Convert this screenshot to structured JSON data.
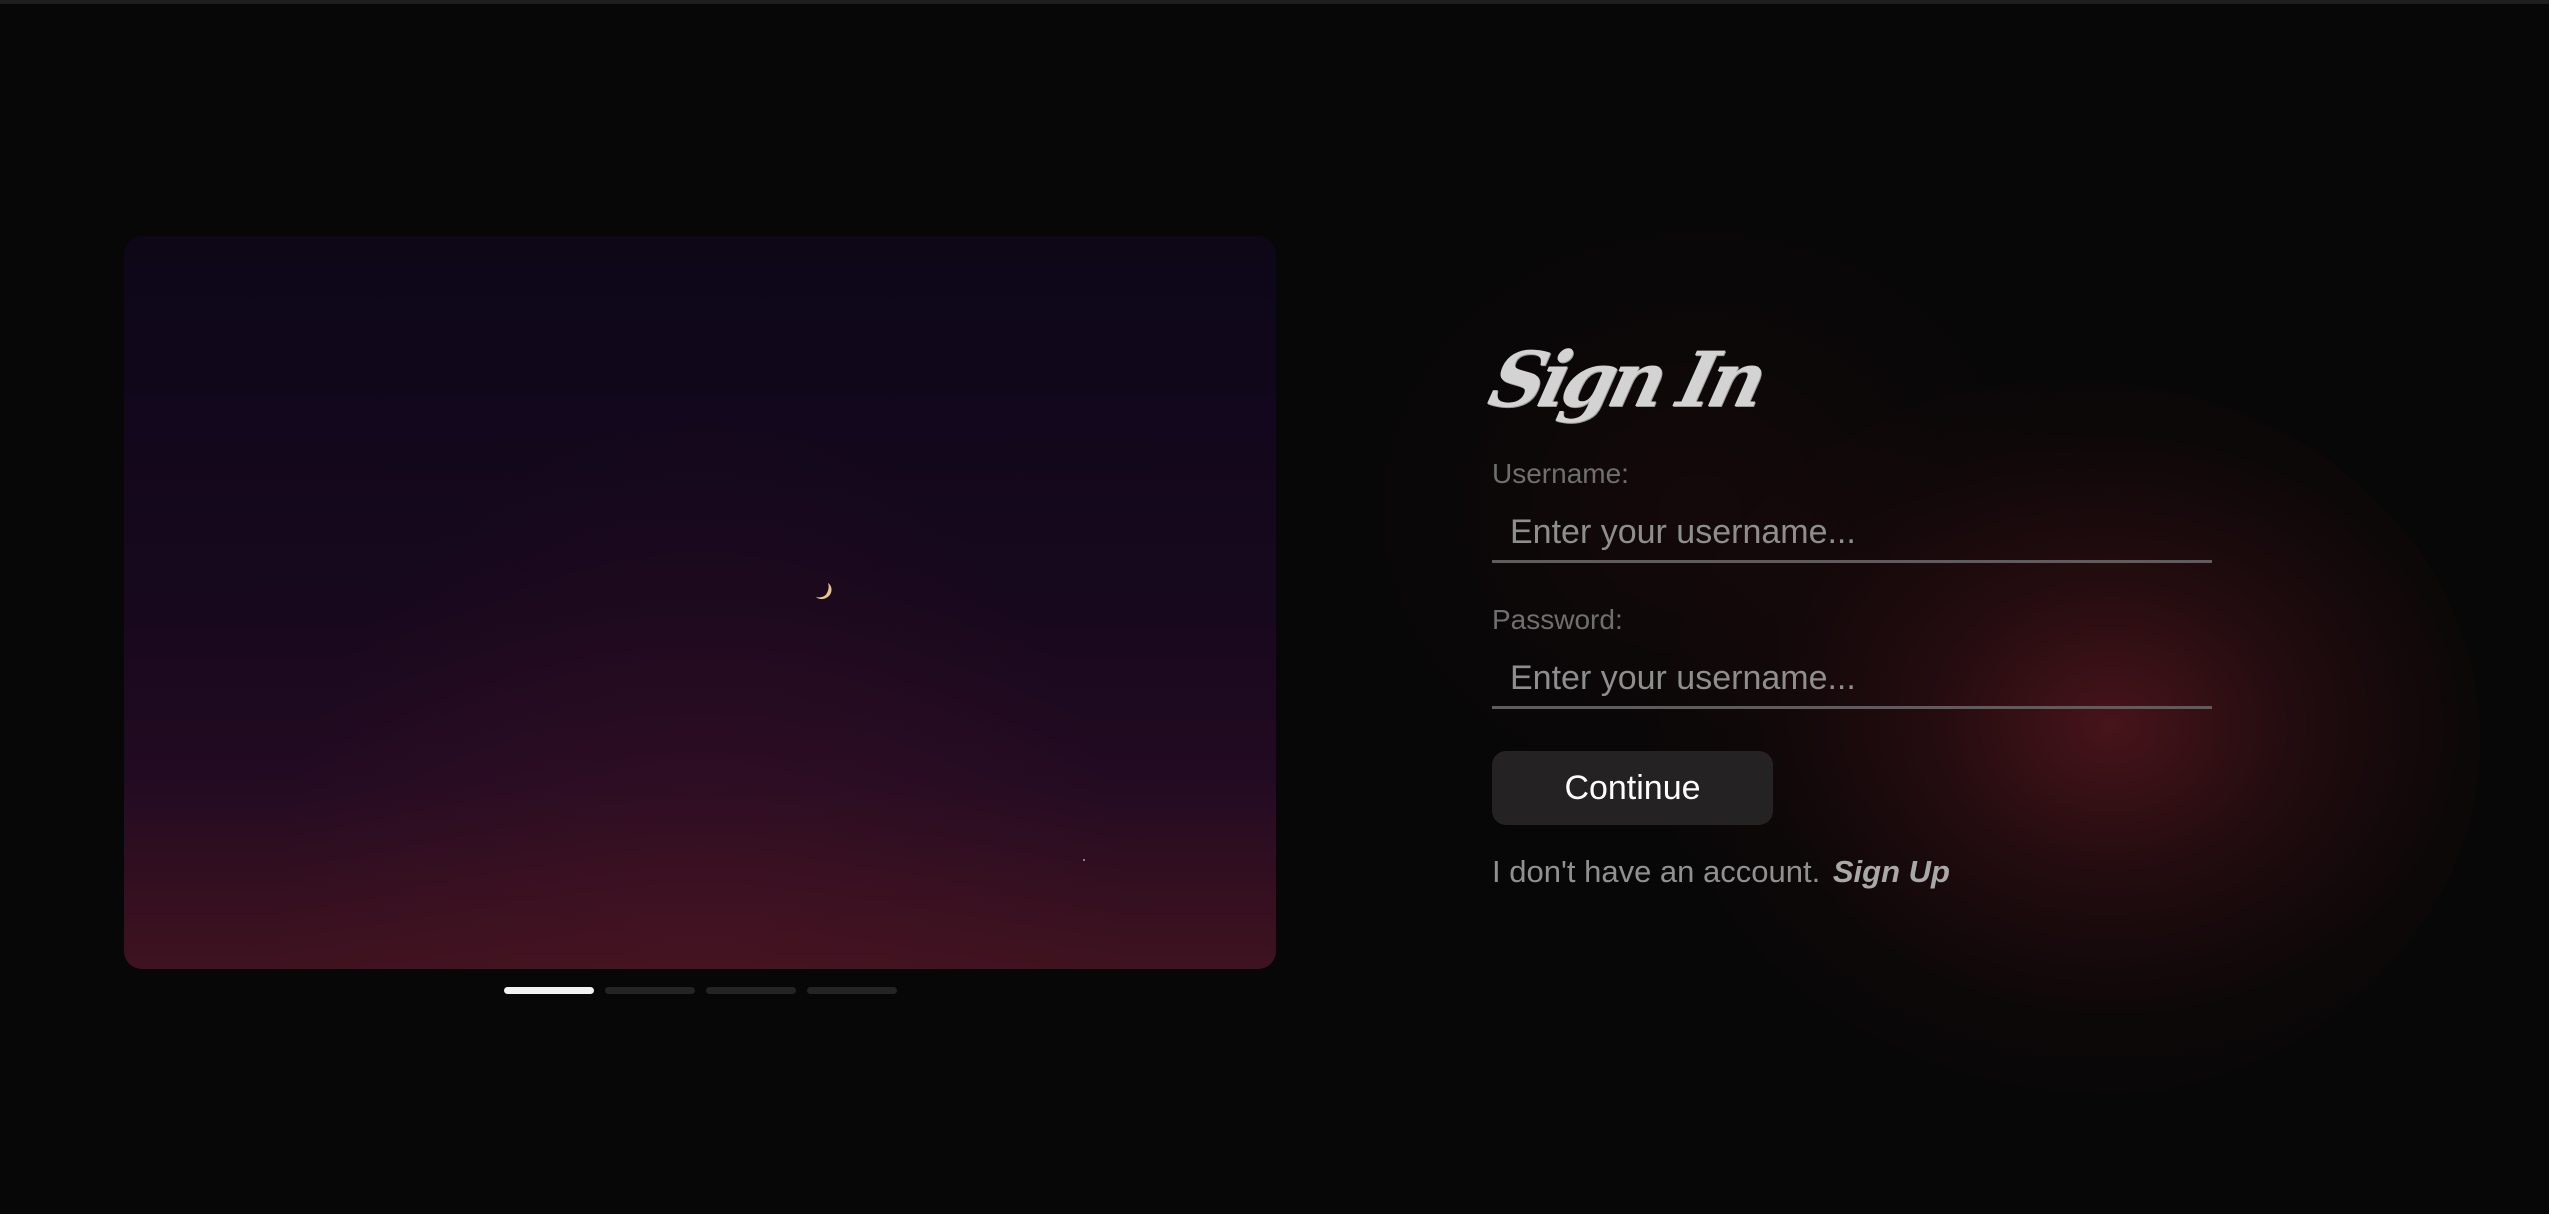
{
  "login": {
    "title": "Sign In",
    "username": {
      "label": "Username:",
      "placeholder": "Enter your username..."
    },
    "password": {
      "label": "Password:",
      "placeholder": "Enter your username..."
    },
    "continue_label": "Continue",
    "no_account_text": "I don't have an account.",
    "signup_label": "Sign Up"
  },
  "carousel": {
    "image": "night-sky-crescent-moon",
    "slide_count": 4,
    "active_slide": 1
  },
  "colors": {
    "background": "#070707",
    "glow": "#6e1c26",
    "button": "#242223",
    "active_indicator": "#f2f2f2",
    "inactive_indicator": "#242424"
  }
}
